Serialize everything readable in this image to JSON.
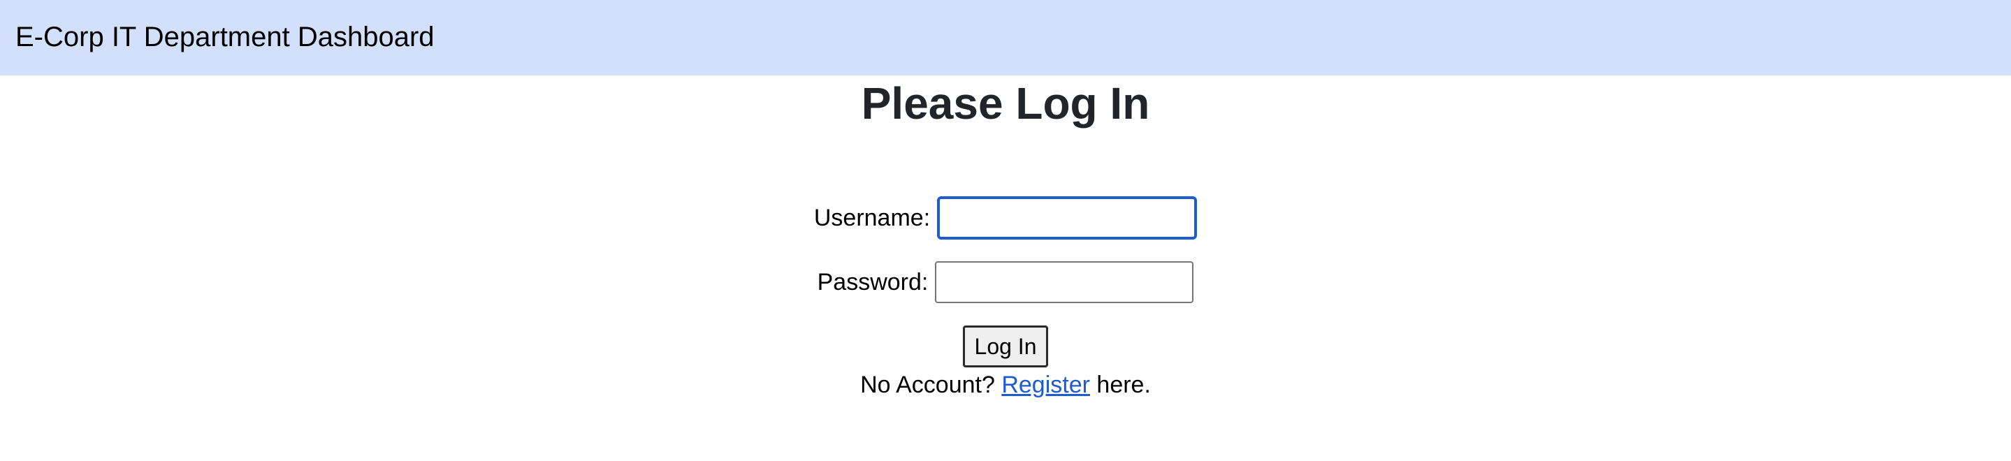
{
  "header": {
    "title": "E-Corp IT Department Dashboard",
    "background_color": "#d2e0fb"
  },
  "main": {
    "title": "Please Log In"
  },
  "login_form": {
    "username_label": "Username:",
    "username_value": "",
    "password_label": "Password:",
    "password_value": "",
    "submit_label": "Log In",
    "focused_field": "username"
  },
  "register": {
    "prefix": "No Account?",
    "link_text": "Register",
    "suffix": "here.",
    "link_color": "#1f5bd0"
  }
}
